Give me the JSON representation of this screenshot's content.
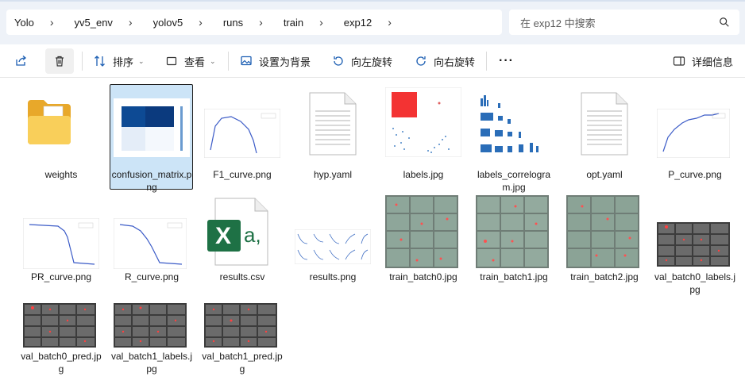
{
  "breadcrumb": {
    "items": [
      "Yolo",
      "yv5_env",
      "yolov5",
      "runs",
      "train",
      "exp12"
    ]
  },
  "search": {
    "placeholder": "在 exp12 中搜索"
  },
  "toolbar": {
    "sort_label": "排序",
    "view_label": "查看",
    "set_background_label": "设置为背景",
    "rotate_left_label": "向左旋转",
    "rotate_right_label": "向右旋转",
    "more_label": "···",
    "details_label": "详细信息"
  },
  "files": [
    {
      "name": "weights",
      "kind": "folder",
      "selected": false
    },
    {
      "name": "confusion_matrix.png",
      "kind": "image",
      "selected": true
    },
    {
      "name": "F1_curve.png",
      "kind": "image",
      "selected": false
    },
    {
      "name": "hyp.yaml",
      "kind": "document",
      "selected": false
    },
    {
      "name": "labels.jpg",
      "kind": "image",
      "selected": false
    },
    {
      "name": "labels_correlogram.jpg",
      "kind": "image",
      "selected": false
    },
    {
      "name": "opt.yaml",
      "kind": "document",
      "selected": false
    },
    {
      "name": "P_curve.png",
      "kind": "image",
      "selected": false
    },
    {
      "name": "PR_curve.png",
      "kind": "image",
      "selected": false
    },
    {
      "name": "R_curve.png",
      "kind": "image",
      "selected": false
    },
    {
      "name": "results.csv",
      "kind": "excel",
      "selected": false
    },
    {
      "name": "results.png",
      "kind": "image",
      "selected": false
    },
    {
      "name": "train_batch0.jpg",
      "kind": "image",
      "selected": false
    },
    {
      "name": "train_batch1.jpg",
      "kind": "image",
      "selected": false
    },
    {
      "name": "train_batch2.jpg",
      "kind": "image",
      "selected": false
    },
    {
      "name": "val_batch0_labels.jpg",
      "kind": "image",
      "selected": false
    },
    {
      "name": "val_batch0_pred.jpg",
      "kind": "image",
      "selected": false
    },
    {
      "name": "val_batch1_labels.jpg",
      "kind": "image",
      "selected": false
    },
    {
      "name": "val_batch1_pred.jpg",
      "kind": "image",
      "selected": false
    }
  ],
  "icons": {
    "excel_glyph": "X",
    "excel_suffix": "a,"
  },
  "colors": {
    "selection": "#cce4f7",
    "folder": "#f5c04a",
    "excel_green": "#1e7145",
    "accent_blue": "#0b5cab"
  }
}
